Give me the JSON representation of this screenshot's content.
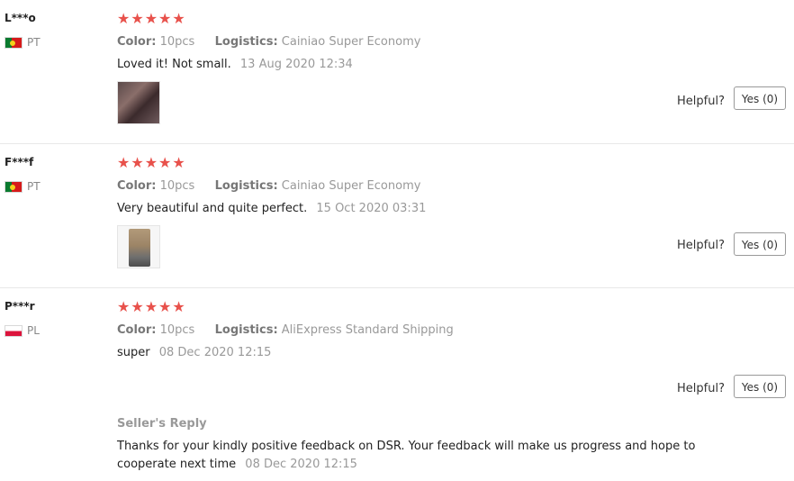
{
  "labels": {
    "color": "Color:",
    "logistics": "Logistics:",
    "helpful": "Helpful?",
    "seller_reply": "Seller's Reply"
  },
  "stars_glyph": "★★★★★",
  "reviews": [
    {
      "user": "L***o",
      "country": "PT",
      "rating": 5,
      "color": "10pcs",
      "logistics": "Cainiao Super Economy",
      "text": "Loved it! Not small.",
      "date": "13 Aug 2020 12:34",
      "helpful_button": "Yes (0)"
    },
    {
      "user": "F***f",
      "country": "PT",
      "rating": 5,
      "color": "10pcs",
      "logistics": "Cainiao Super Economy",
      "text": "Very beautiful and quite perfect.",
      "date": "15 Oct 2020 03:31",
      "helpful_button": "Yes (0)"
    },
    {
      "user": "P***r",
      "country": "PL",
      "rating": 5,
      "color": "10pcs",
      "logistics": "AliExpress Standard Shipping",
      "text": "super",
      "date": "08 Dec 2020 12:15",
      "helpful_button": "Yes (0)",
      "seller_reply": {
        "text": "Thanks for your kindly positive feedback on DSR. Your feedback will make us progress and hope to cooperate next time",
        "date": "08 Dec 2020 12:15"
      }
    }
  ],
  "colors": {
    "star": "#e8514b",
    "muted": "#999999",
    "divider": "#e8e8e8"
  }
}
